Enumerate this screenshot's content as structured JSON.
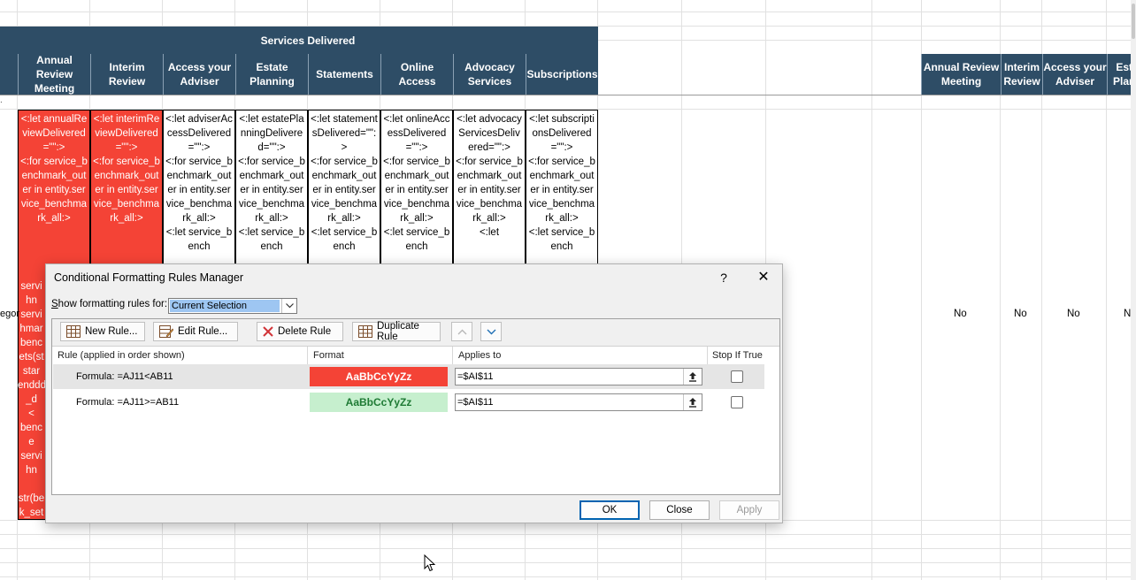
{
  "sheet": {
    "band_title": "Services Delivered",
    "headers": [
      "Annual Review Meeting",
      "Interim Review",
      "Access your Adviser",
      "Estate Planning",
      "Statements",
      "Online Access",
      "Advocacy Services",
      "Subscriptions"
    ],
    "right_headers": [
      "Annual Review Meeting",
      "Interim Review",
      "Access your Adviser",
      "Est Plan"
    ],
    "cells": [
      "<:let annualReviewDelivered=\"\":>\n<:for service_benchmark_outer in entity.service_benchmark_all:>",
      "<:let interimReviewDelivered=\"\":>\n<:for service_benchmark_outer in entity.service_benchmark_all:>",
      "<:let adviserAccessDelivered=\"\":>\n<:for service_benchmark_outer in entity.service_benchmark_all:>\n<:let service_bench",
      "<:let estatePlanningDelivered=\"\":>\n<:for service_benchmark_outer in entity.service_benchmark_all:>\n<:let service_bench",
      "<:let statementsDelivered=\"\":>\n<:for service_benchmark_outer in entity.service_benchmark_all:>\n<:let service_bench",
      "<:let onlineAccessDelivered=\"\":>\n<:for service_benchmark_outer in entity.service_benchmark_all:>\n<:let service_bench",
      "<:let advocacyServicesDelivered=\"\":>\n<:for service_benchmark_outer in entity.service_benchmark_all:>\n<:let",
      "<:let subscriptionsDelivered=\"\":>\n<:for service_benchmark_outer in entity.service_benchmark_all:>\n<:let service_bench"
    ],
    "red_cell_tail_lines": [
      "servi",
      "hn",
      "servi",
      "hmar",
      "benc",
      "ets(st",
      "star",
      "enddd",
      "_d",
      "<",
      "benc",
      "e",
      "servi",
      "hn",
      "",
      "str(be",
      "k_set"
    ],
    "left_fragment": "egor",
    "right_no_values": [
      "No",
      "No",
      "No",
      "N"
    ]
  },
  "dialog": {
    "title": "Conditional Formatting Rules Manager",
    "help_label": "?",
    "close_label": "✕",
    "show_rules_label": "Show formatting rules for:",
    "show_rules_value": "Current Selection",
    "toolbar": {
      "new_rule": "New Rule...",
      "edit_rule": "Edit Rule...",
      "delete_rule": "Delete Rule",
      "duplicate_rule": "Duplicate Rule"
    },
    "columns": {
      "rule": "Rule (applied in order shown)",
      "format": "Format",
      "applies_to": "Applies to",
      "stop_if_true": "Stop If True"
    },
    "rules": [
      {
        "rule": "Formula: =AJ11<AB11",
        "preview": "AaBbCcYyZz",
        "applies_to": "=$AI$11",
        "stop_if_true": false,
        "preview_bg": "#f44336",
        "preview_fg": "#ffffff"
      },
      {
        "rule": "Formula: =AJ11>=AB11",
        "preview": "AaBbCcYyZz",
        "applies_to": "=$AI$11",
        "stop_if_true": false,
        "preview_bg": "#c6efce",
        "preview_fg": "#1e7a34"
      }
    ],
    "buttons": {
      "ok": "OK",
      "close": "Close",
      "apply": "Apply"
    }
  },
  "colors": {
    "header_blue": "#2e4d66",
    "red_fill": "#f44336",
    "green_fill": "#c6efce",
    "selection_blue": "#9ec6f2"
  }
}
